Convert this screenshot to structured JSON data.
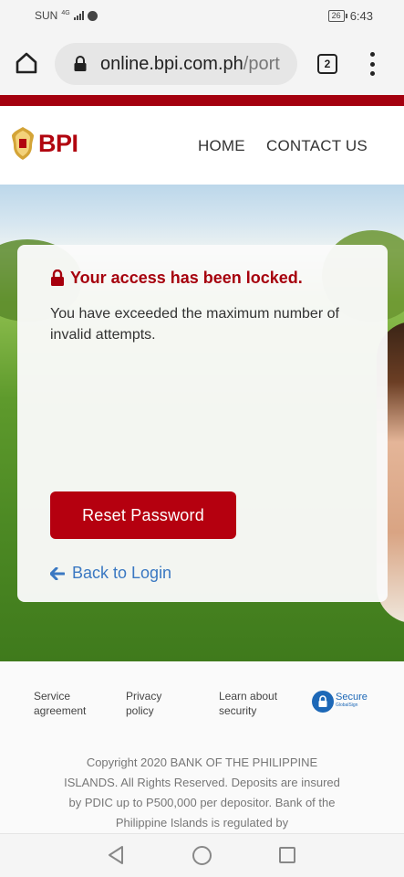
{
  "status_bar": {
    "carrier": "SUN",
    "network": "4G",
    "battery": "26",
    "time": "6:43"
  },
  "browser": {
    "url_host": "online.bpi.com.ph",
    "url_path": "/port",
    "tab_count": "2"
  },
  "header": {
    "logo_text": "BPI",
    "nav": {
      "home": "HOME",
      "contact": "CONTACT US"
    }
  },
  "card": {
    "title": "Your access has been locked.",
    "message": "You have exceeded the maximum number of invalid attempts.",
    "reset_button": "Reset Password",
    "back_link": "Back to Login"
  },
  "footer": {
    "links": {
      "service": "Service agreement",
      "privacy": "Privacy policy",
      "security": "Learn about security"
    },
    "secure_badge": "Secure",
    "secure_sub": "GlobalSign",
    "copyright": "Copyright 2020 BANK OF THE PHILIPPINE ISLANDS. All Rights Reserved. Deposits are insured by PDIC up to P500,000 per depositor. Bank of the Philippine Islands is regulated by"
  },
  "colors": {
    "brand_red": "#b5000f",
    "link_blue": "#3a78c2"
  },
  "icons": [
    "home-icon",
    "lock-icon",
    "tabs-icon",
    "menu-icon",
    "bpi-logo-icon",
    "padlock-icon",
    "arrow-left-icon",
    "secure-lock-icon",
    "nav-back-icon",
    "nav-home-icon",
    "nav-recent-icon"
  ]
}
